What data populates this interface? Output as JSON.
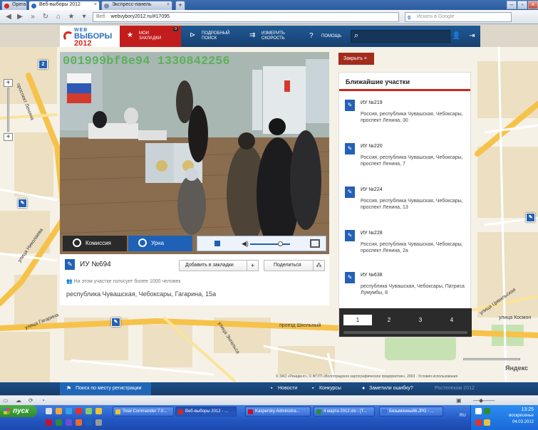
{
  "browser": {
    "tabs": [
      {
        "label": "Opera",
        "color": "#d7281c"
      },
      {
        "label": "Веб-выборы 2012",
        "color": "#2a6dbd"
      },
      {
        "label": "Экспресс-панель",
        "color": "#7a8ea9"
      }
    ],
    "url_prefix": "Веб",
    "url": "webvybory2012.ru/#17095",
    "search_placeholder": "Искать в Google"
  },
  "site": {
    "logo_top": "WEB",
    "logo_main_a": "ВЫБОРЫ ",
    "logo_main_b": "2012",
    "nav": [
      {
        "label": "МОИ\nЗАКЛАДКИ",
        "icon": "star-icon",
        "badge": "0"
      },
      {
        "label": "ПОДРОБНЫЙ\nПОИСК",
        "icon": "search-detail-icon"
      },
      {
        "label": "ИЗМЕРИТЬ\nСКОРОСТЬ",
        "icon": "speed-icon"
      },
      {
        "label": "ПОМОЩЬ",
        "icon": "help-icon"
      }
    ]
  },
  "video": {
    "overlay": "001999bf8e94 1330842256",
    "btn_commission": "Комиссия",
    "btn_urn": "Урна",
    "volume_level": 0.75
  },
  "station": {
    "title": "ИУ №694",
    "bookmark_label": "Добавить в закладки",
    "share_label": "Поделиться",
    "note": "На этом участке голосует более 1000 человек",
    "address": "республика Чувашская, Чебоксары, Гагарина, 15а"
  },
  "panel": {
    "close_label": "Закрыть  ×",
    "title": "Ближайшие участки",
    "items": [
      {
        "title": "ИУ №219",
        "address": "Россия, республика Чувашская, Чебоксары, проспект Ленина, 30"
      },
      {
        "title": "ИУ №220",
        "address": "Россия, республика Чувашская, Чебоксары, проспект Ленина, 7"
      },
      {
        "title": "ИУ №224",
        "address": "Россия, республика Чувашская, Чебоксары, проспект Ленина, 13"
      },
      {
        "title": "ИУ №228",
        "address": "Россия, республика Чувашская, Чебоксары, проспект Ленина, 2а"
      },
      {
        "title": "ИУ №638",
        "address": "республика Чувашская, Чебоксары, Патриса Лумумбы, 8"
      }
    ],
    "pages": [
      "1",
      "2",
      "3",
      "4"
    ],
    "current_page": "1"
  },
  "map": {
    "labels": {
      "lenina": "проспект Ленина",
      "nikolaev": "улица Николаева",
      "gagarina": "улица Гагарина",
      "engelsa": "улица Энгельса",
      "shkolny": "проезд Школьный",
      "tsivilskaya": "улица Цивильская",
      "kosmon": "улица Космон"
    },
    "cluster_count": "2",
    "yandex": "Яндекс",
    "copyright": "© ЗАО «Резидент», © ФГУП «Волгоградское картографическое предприятие», 2003 · Условия использования"
  },
  "footer": {
    "search_by_reg": "Поиск по месту регистрации",
    "news": "Новости",
    "contests": "Конкурсы",
    "report_error": "Заметили ошибку?",
    "copyright": "Ростелеком 2012"
  },
  "taskbar": {
    "start": "пуск",
    "buttons": [
      {
        "label": "Total Commander 7.0...",
        "color": "#e8c43a"
      },
      {
        "label": "Веб-выборы 2012 - ...",
        "color": "#d7281c"
      },
      {
        "label": "Kaspersky Administra...",
        "color": "#c8102e"
      },
      {
        "label": "4 марта 2012.xls - [Т...",
        "color": "#2e8b3a"
      },
      {
        "label": "Безымянный6.JPG - ...",
        "color": "#3a6fd8"
      }
    ],
    "lang": "RU",
    "time": "13:25",
    "day": "воскресенье",
    "date": "04.03.2012"
  }
}
